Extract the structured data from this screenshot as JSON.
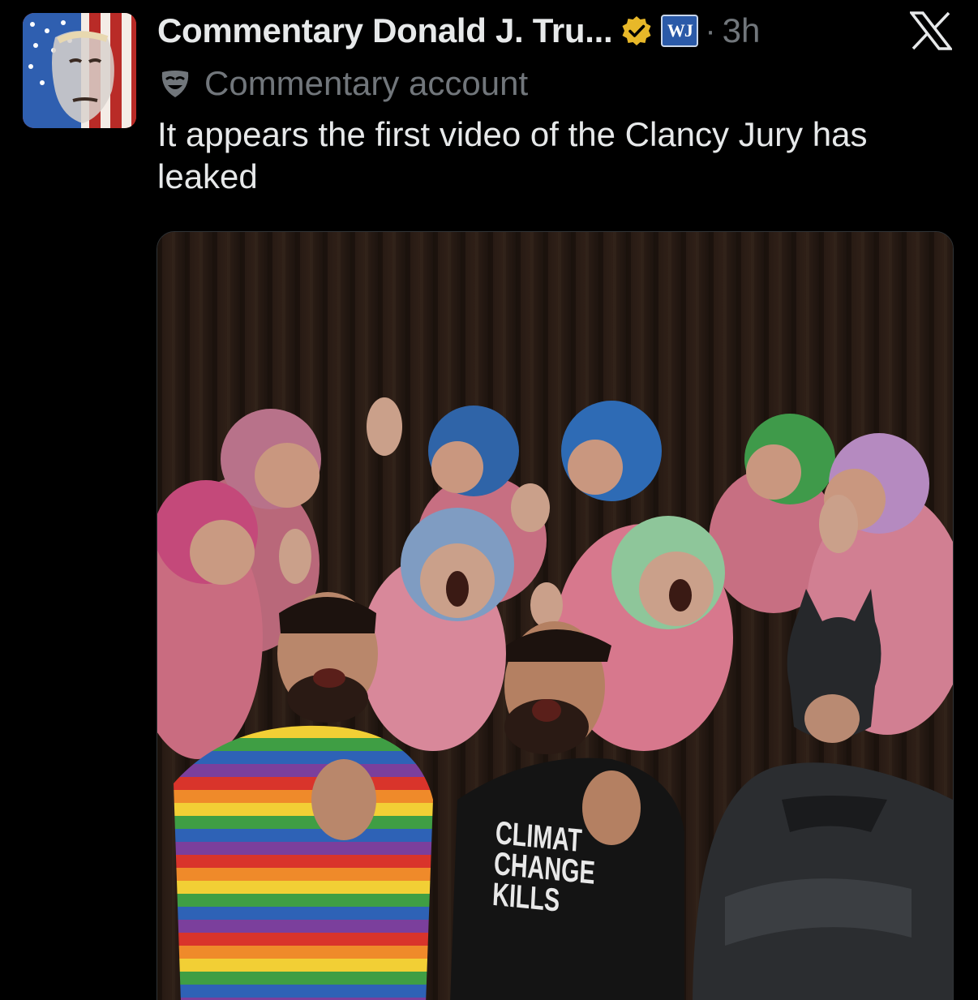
{
  "post": {
    "display_name": "Commentary Donald J. Tru...",
    "affiliate_badge": "WJ",
    "separator": "·",
    "time": "3h",
    "account_label": "Commentary account",
    "text": "It appears the first video of the Clancy Jury has leaked"
  },
  "media": {
    "shirt_lines": [
      "CLIMAT",
      "CHANGE",
      "KILLS"
    ]
  },
  "icons": {
    "verified": "verified-badge-icon",
    "label": "parody-mask-icon",
    "logo": "x-logo-icon"
  },
  "colors": {
    "background": "#000000",
    "text_primary": "#e7e9ea",
    "text_secondary": "#71767b",
    "verified_gold": "#e8b829"
  }
}
